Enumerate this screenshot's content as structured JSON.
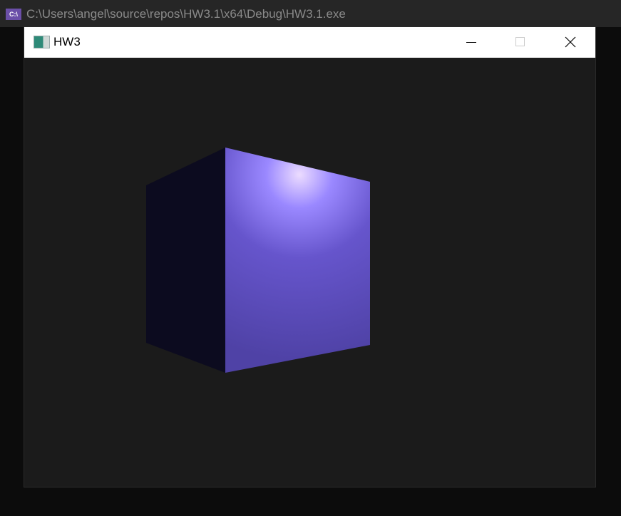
{
  "console": {
    "title": "C:\\Users\\angel\\source\\repos\\HW3.1\\x64\\Debug\\HW3.1.exe",
    "icon": "C:\\"
  },
  "window": {
    "title": "HW3"
  },
  "scene": {
    "cube_color": "#6a5ad8",
    "shadow_color": "#0c0b1f",
    "highlight_color": "#e8d8ff",
    "background": "#1b1b1b"
  }
}
